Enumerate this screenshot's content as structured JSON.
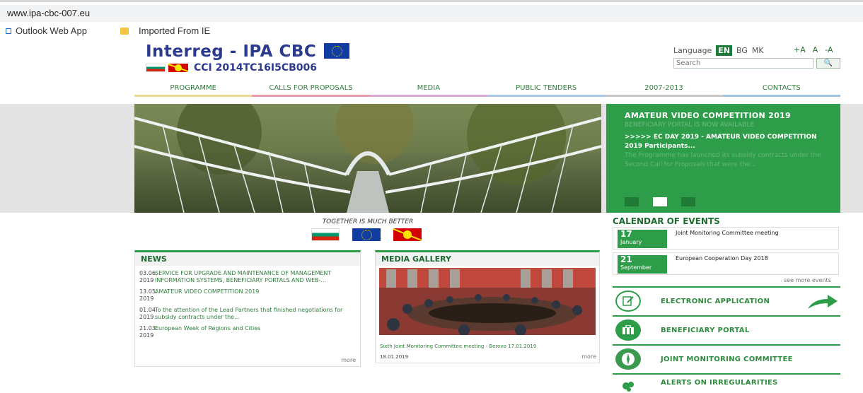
{
  "browser": {
    "address": "www.ipa-cbc-007.eu",
    "bookmarks": [
      {
        "label": "Outlook Web App"
      },
      {
        "label": "Imported From IE"
      }
    ]
  },
  "header": {
    "logo_title": "Interreg - IPA CBC",
    "logo_code": "CCI 2014TC16I5CB006",
    "language_label": "Language",
    "languages": [
      "EN",
      "BG",
      "MK"
    ],
    "active_language": "EN",
    "font_sizes": [
      "+A",
      "A",
      "-A"
    ],
    "search_placeholder": "Search",
    "search_button": "🔍"
  },
  "nav": [
    "PROGRAMME",
    "CALLS FOR PROPOSALS",
    "MEDIA",
    "PUBLIC TENDERS",
    "2007-2013",
    "CONTACTS"
  ],
  "nav_colors": [
    "#e8dc90",
    "#e89aa8",
    "#d8a8d8",
    "#a8c8e8",
    "#c8c8c8",
    "#9cc4e4"
  ],
  "slider": {
    "title": "AMATEUR VIDEO COMPETITION 2019",
    "ghost_title": "BENEFICIARY PORTAL IS NOW AVAILABLE",
    "text": ">>>>> EC DAY 2019 - AMATEUR VIDEO COMPETITION 2019 Participants...",
    "ghost_text": "The Programme has launched its subsidy contracts under the Second Call for Proposals that were the..."
  },
  "together": "TOGETHER IS MUCH BETTER",
  "news": {
    "title": "NEWS",
    "items": [
      {
        "date": "03.06. 2019",
        "text": "SERVICE FOR UPGRADE AND MAINTENANCE OF MANAGEMENT INFORMATION SYSTEMS, BENEFICIARY PORTALS AND WEB-..."
      },
      {
        "date": "13.05. 2019",
        "text": "AMATEUR VIDEO COMPETITION 2019"
      },
      {
        "date": "01.04. 2019",
        "text": "To the attention of the Lead Partners that finished negotiations for subsidy contracts under the..."
      },
      {
        "date": "21.03. 2019",
        "text": "European Week of Regions and Cities"
      }
    ],
    "more": "more"
  },
  "media": {
    "title": "MEDIA GALLERY",
    "caption": "Sixth Joint Monitoring Committee meeting - Berovo 17.01.2019",
    "date": "18.01.2019",
    "more": "more"
  },
  "calendar": {
    "title": "CALENDAR OF EVENTS",
    "events": [
      {
        "day": "17",
        "month": "January",
        "text": "Joint Monitoring Committee meeting"
      },
      {
        "day": "21",
        "month": "September",
        "text": "European Cooperation Day 2018"
      }
    ],
    "see_more": "see more events"
  },
  "quick_links": [
    {
      "label": "ELECTRONIC APPLICATION",
      "icon": "document-edit-icon"
    },
    {
      "label": "BENEFICIARY PORTAL",
      "icon": "briefcase-icon"
    },
    {
      "label": "JOINT MONITORING COMMITTEE",
      "icon": "compass-icon"
    },
    {
      "label": "ALERTS ON IRREGULARITIES",
      "icon": "alert-icon"
    }
  ],
  "colors": {
    "accent_green": "#2e9d49",
    "dark_green": "#1d6a30",
    "logo_blue": "#2b3a8f"
  }
}
